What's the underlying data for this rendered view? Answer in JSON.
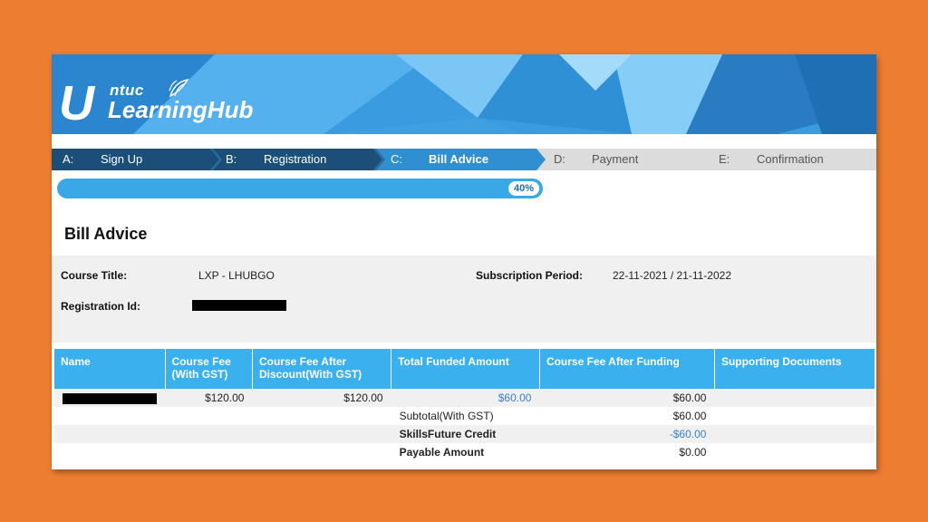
{
  "brand": {
    "ntuc": "ntuc",
    "name": "LearningHub"
  },
  "steps": [
    {
      "letter": "A:",
      "label": "Sign Up",
      "state": "done"
    },
    {
      "letter": "B:",
      "label": "Registration",
      "state": "done"
    },
    {
      "letter": "C:",
      "label": "Bill Advice",
      "state": "current"
    },
    {
      "letter": "D:",
      "label": "Payment",
      "state": "todo"
    },
    {
      "letter": "E:",
      "label": "Confirmation",
      "state": "todo"
    }
  ],
  "progress": {
    "value": 40,
    "label": "40%"
  },
  "page_title": "Bill Advice",
  "info": {
    "course_title_label": "Course Title:",
    "course_title": "LXP - LHUBGO",
    "period_label": "Subscription Period:",
    "period": "22-11-2021 / 21-11-2022",
    "reg_label": "Registration Id:"
  },
  "table": {
    "headers": [
      "Name",
      "Course Fee (With GST)",
      "Course Fee After Discount(With GST)",
      "Total Funded Amount",
      "Course Fee After Funding",
      "Supporting Documents"
    ],
    "row": {
      "fee": "$120.00",
      "fee_after_discount": "$120.00",
      "funded": "$60.00",
      "after_funding": "$60.00"
    },
    "subtotal_label": "Subtotal(With GST)",
    "subtotal": "$60.00",
    "skills_label": "SkillsFuture Credit",
    "skills": "-$60.00",
    "payable_label": "Payable Amount",
    "payable": "$0.00"
  },
  "colors": {
    "page_bg": "#ED7D31",
    "step_done": "#1b4f7a",
    "step_current": "#2f8fd0",
    "step_todo": "#dcdcdc",
    "table_header": "#3ab0ee",
    "link_blue": "#3a7fd0"
  }
}
